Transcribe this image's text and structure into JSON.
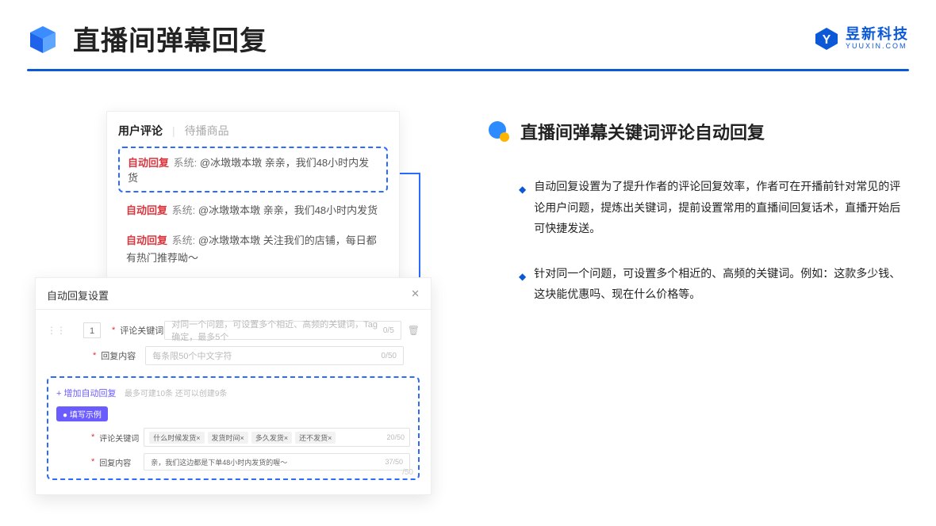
{
  "header": {
    "title": "直播间弹幕回复",
    "brand_cn": "昱新科技",
    "brand_en": "YUUXIN.COM"
  },
  "comments_panel": {
    "tab_active": "用户评论",
    "tab_inactive": "待播商品",
    "auto_label": "自动回复",
    "sys_label": "系统:",
    "highlight_text": " @冰墩墩本墩 亲亲，我们48小时内发货",
    "row2": " @冰墩墩本墩 亲亲，我们48小时内发货",
    "row3": " @冰墩墩本墩 关注我们的店铺，每日都有热门推荐呦～"
  },
  "settings_panel": {
    "title": "自动回复设置",
    "index": "1",
    "label_keyword": "评论关键词",
    "label_reply": "回复内容",
    "ph_keyword": "对同一个问题，可设置多个相近、高频的关键词，Tag确定，最多5个",
    "count_keyword": "0/5",
    "ph_reply": "每条限50个中文字符",
    "count_reply": "0/50",
    "add_link": "+ 增加自动回复",
    "add_note": "最多可建10条 还可以创建9条",
    "example_badge": "● 填写示例",
    "example_tags": [
      "什么时候发货×",
      "发货时间×",
      "多久发货×",
      "还不发货×"
    ],
    "example_tags_count": "20/50",
    "example_reply": "亲，我们这边都是下单48小时内发货的喔～",
    "example_reply_count": "37/50",
    "stray_count": "/50"
  },
  "right": {
    "subtitle": "直播间弹幕关键词评论自动回复",
    "bullet1": "自动回复设置为了提升作者的评论回复效率，作者可在开播前针对常见的评论用户问题，提炼出关键词，提前设置常用的直播间回复话术，直播开始后可快捷发送。",
    "bullet2": "针对同一个问题，可设置多个相近的、高频的关键词。例如：这款多少钱、这块能优惠吗、现在什么价格等。"
  }
}
